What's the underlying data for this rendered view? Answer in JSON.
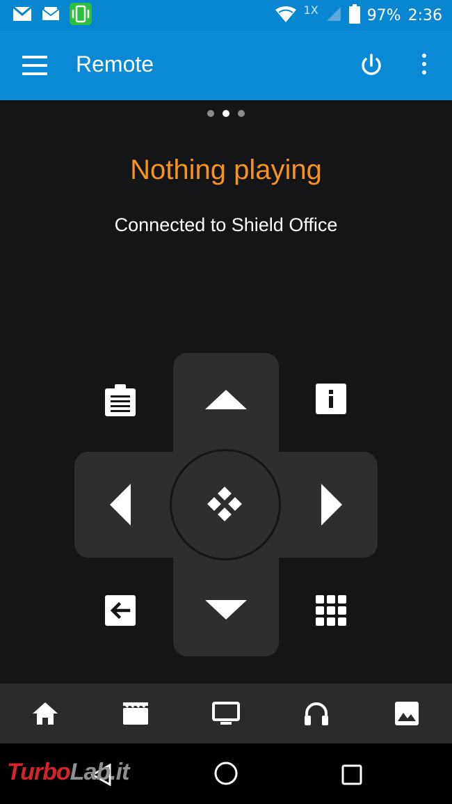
{
  "status_bar": {
    "network_label": "1X",
    "battery": "97%",
    "time": "2:36"
  },
  "app_bar": {
    "title": "Remote"
  },
  "pager": {
    "pages": 3,
    "active_index": 1
  },
  "now_playing": {
    "status": "Nothing playing",
    "connection": "Connected to Shield Office"
  },
  "remote": {
    "buttons": [
      "clipboard-icon",
      "arrow-up-icon",
      "info-icon",
      "arrow-left-icon",
      "select-icon",
      "arrow-right-icon",
      "back-icon",
      "arrow-down-icon",
      "grid-icon"
    ]
  },
  "bottom_nav": {
    "items": [
      "home-icon",
      "movies-icon",
      "tv-icon",
      "music-icon",
      "pictures-icon"
    ]
  },
  "watermark": {
    "part1": "Turbo",
    "part2": "Lab.it"
  },
  "colors": {
    "status_bar": "#0887d0",
    "app_bar": "#0a89d4",
    "background": "#141517",
    "accent": "#f7931e",
    "pad": "#2d2e30",
    "bottom_nav": "#2a2b2d"
  }
}
